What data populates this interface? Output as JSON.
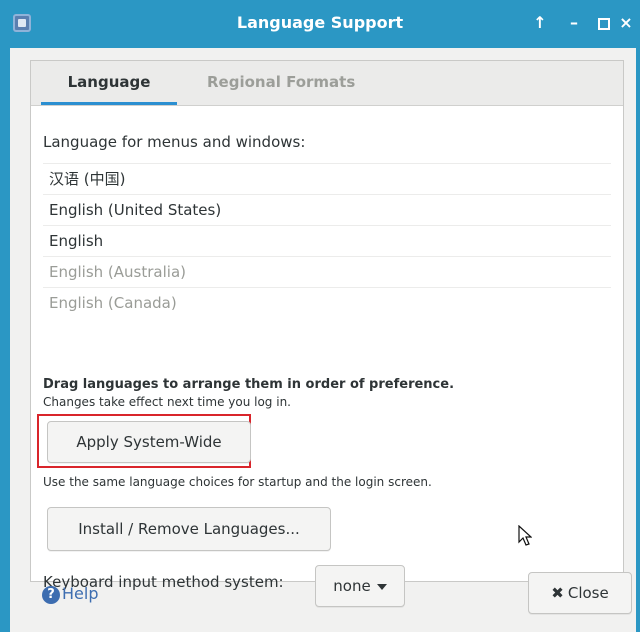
{
  "window": {
    "title": "Language Support",
    "buttons": {
      "up": "↑",
      "minimize": "–",
      "close": "×"
    }
  },
  "tabs": [
    {
      "label": "Language",
      "active": true
    },
    {
      "label": "Regional Formats",
      "active": false
    }
  ],
  "language_tab": {
    "heading": "Language for menus and windows:",
    "languages": [
      {
        "label": "汉语 (中国)",
        "enabled": true
      },
      {
        "label": "English (United States)",
        "enabled": true
      },
      {
        "label": "English",
        "enabled": true
      },
      {
        "label": "English (Australia)",
        "enabled": false
      },
      {
        "label": "English (Canada)",
        "enabled": false
      }
    ],
    "drag_hint": "Drag languages to arrange them in order of preference.",
    "effect_hint": "Changes take effect next time you log in.",
    "apply_button": "Apply System-Wide",
    "apply_note": "Use the same language choices for startup and the login screen.",
    "install_button": "Install / Remove Languages...",
    "keyboard_label": "Keyboard input method system:",
    "keyboard_value": "none"
  },
  "footer": {
    "help_icon": "?",
    "help_label": "Help",
    "close_label": "Close",
    "close_icon": "✖"
  },
  "colors": {
    "titlebar": "#2b97c4",
    "highlight": "#d9252b",
    "tab_accent": "#2b8fd1",
    "link": "#3d6db0"
  }
}
